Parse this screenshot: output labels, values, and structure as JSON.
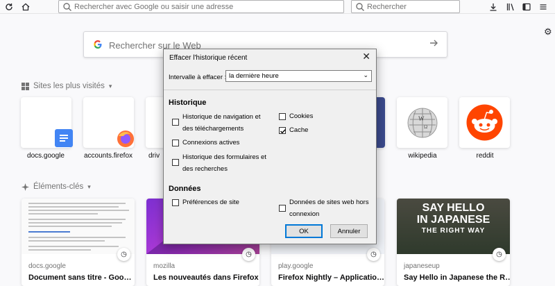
{
  "toolbar": {
    "url_placeholder": "Rechercher avec Google ou saisir une adresse",
    "search_placeholder": "Rechercher"
  },
  "newtab": {
    "search_placeholder": "Rechercher sur le Web",
    "top_sites_title": "Sites les plus visités",
    "highlights_title": "Éléments-clés",
    "top_sites": [
      {
        "label": "docs.google"
      },
      {
        "label": "accounts.firefox"
      },
      {
        "label": "driv"
      },
      {
        "label": "wikipedia"
      },
      {
        "label": "reddit"
      }
    ],
    "highlights": [
      {
        "host": "docs.google",
        "title": "Document sans titre - Goo…"
      },
      {
        "host": "mozilla",
        "title": "Les nouveautés dans Firefox"
      },
      {
        "host": "play.google",
        "title": "Firefox Nightly – Applicatio…"
      },
      {
        "host": "japaneseup",
        "title": "Say Hello in Japanese the R…"
      }
    ],
    "japanese_card_image_text": [
      "SAY HELLO",
      "IN JAPANESE",
      "THE RIGHT WAY"
    ]
  },
  "dialog": {
    "title": "Effacer l'historique récent",
    "range_label": "Intervalle à effacer :",
    "range_value": "la dernière heure",
    "history_heading": "Historique",
    "history_items": [
      {
        "label": "Historique de navigation et des téléchargements",
        "checked": false
      },
      {
        "label": "Connexions actives",
        "checked": false
      },
      {
        "label": "Historique des formulaires et des recherches",
        "checked": false
      }
    ],
    "history_items_right": [
      {
        "label": "Cookies",
        "checked": false
      },
      {
        "label": "Cache",
        "checked": true
      }
    ],
    "data_heading": "Données",
    "data_items": [
      {
        "label": "Préférences de site",
        "checked": false
      },
      {
        "label": "Données de sites web hors connexion",
        "checked": false
      }
    ],
    "ok_label": "OK",
    "cancel_label": "Annuler"
  },
  "colors": {
    "accent": "#0078d7",
    "page_bg": "#f9f9fb"
  }
}
